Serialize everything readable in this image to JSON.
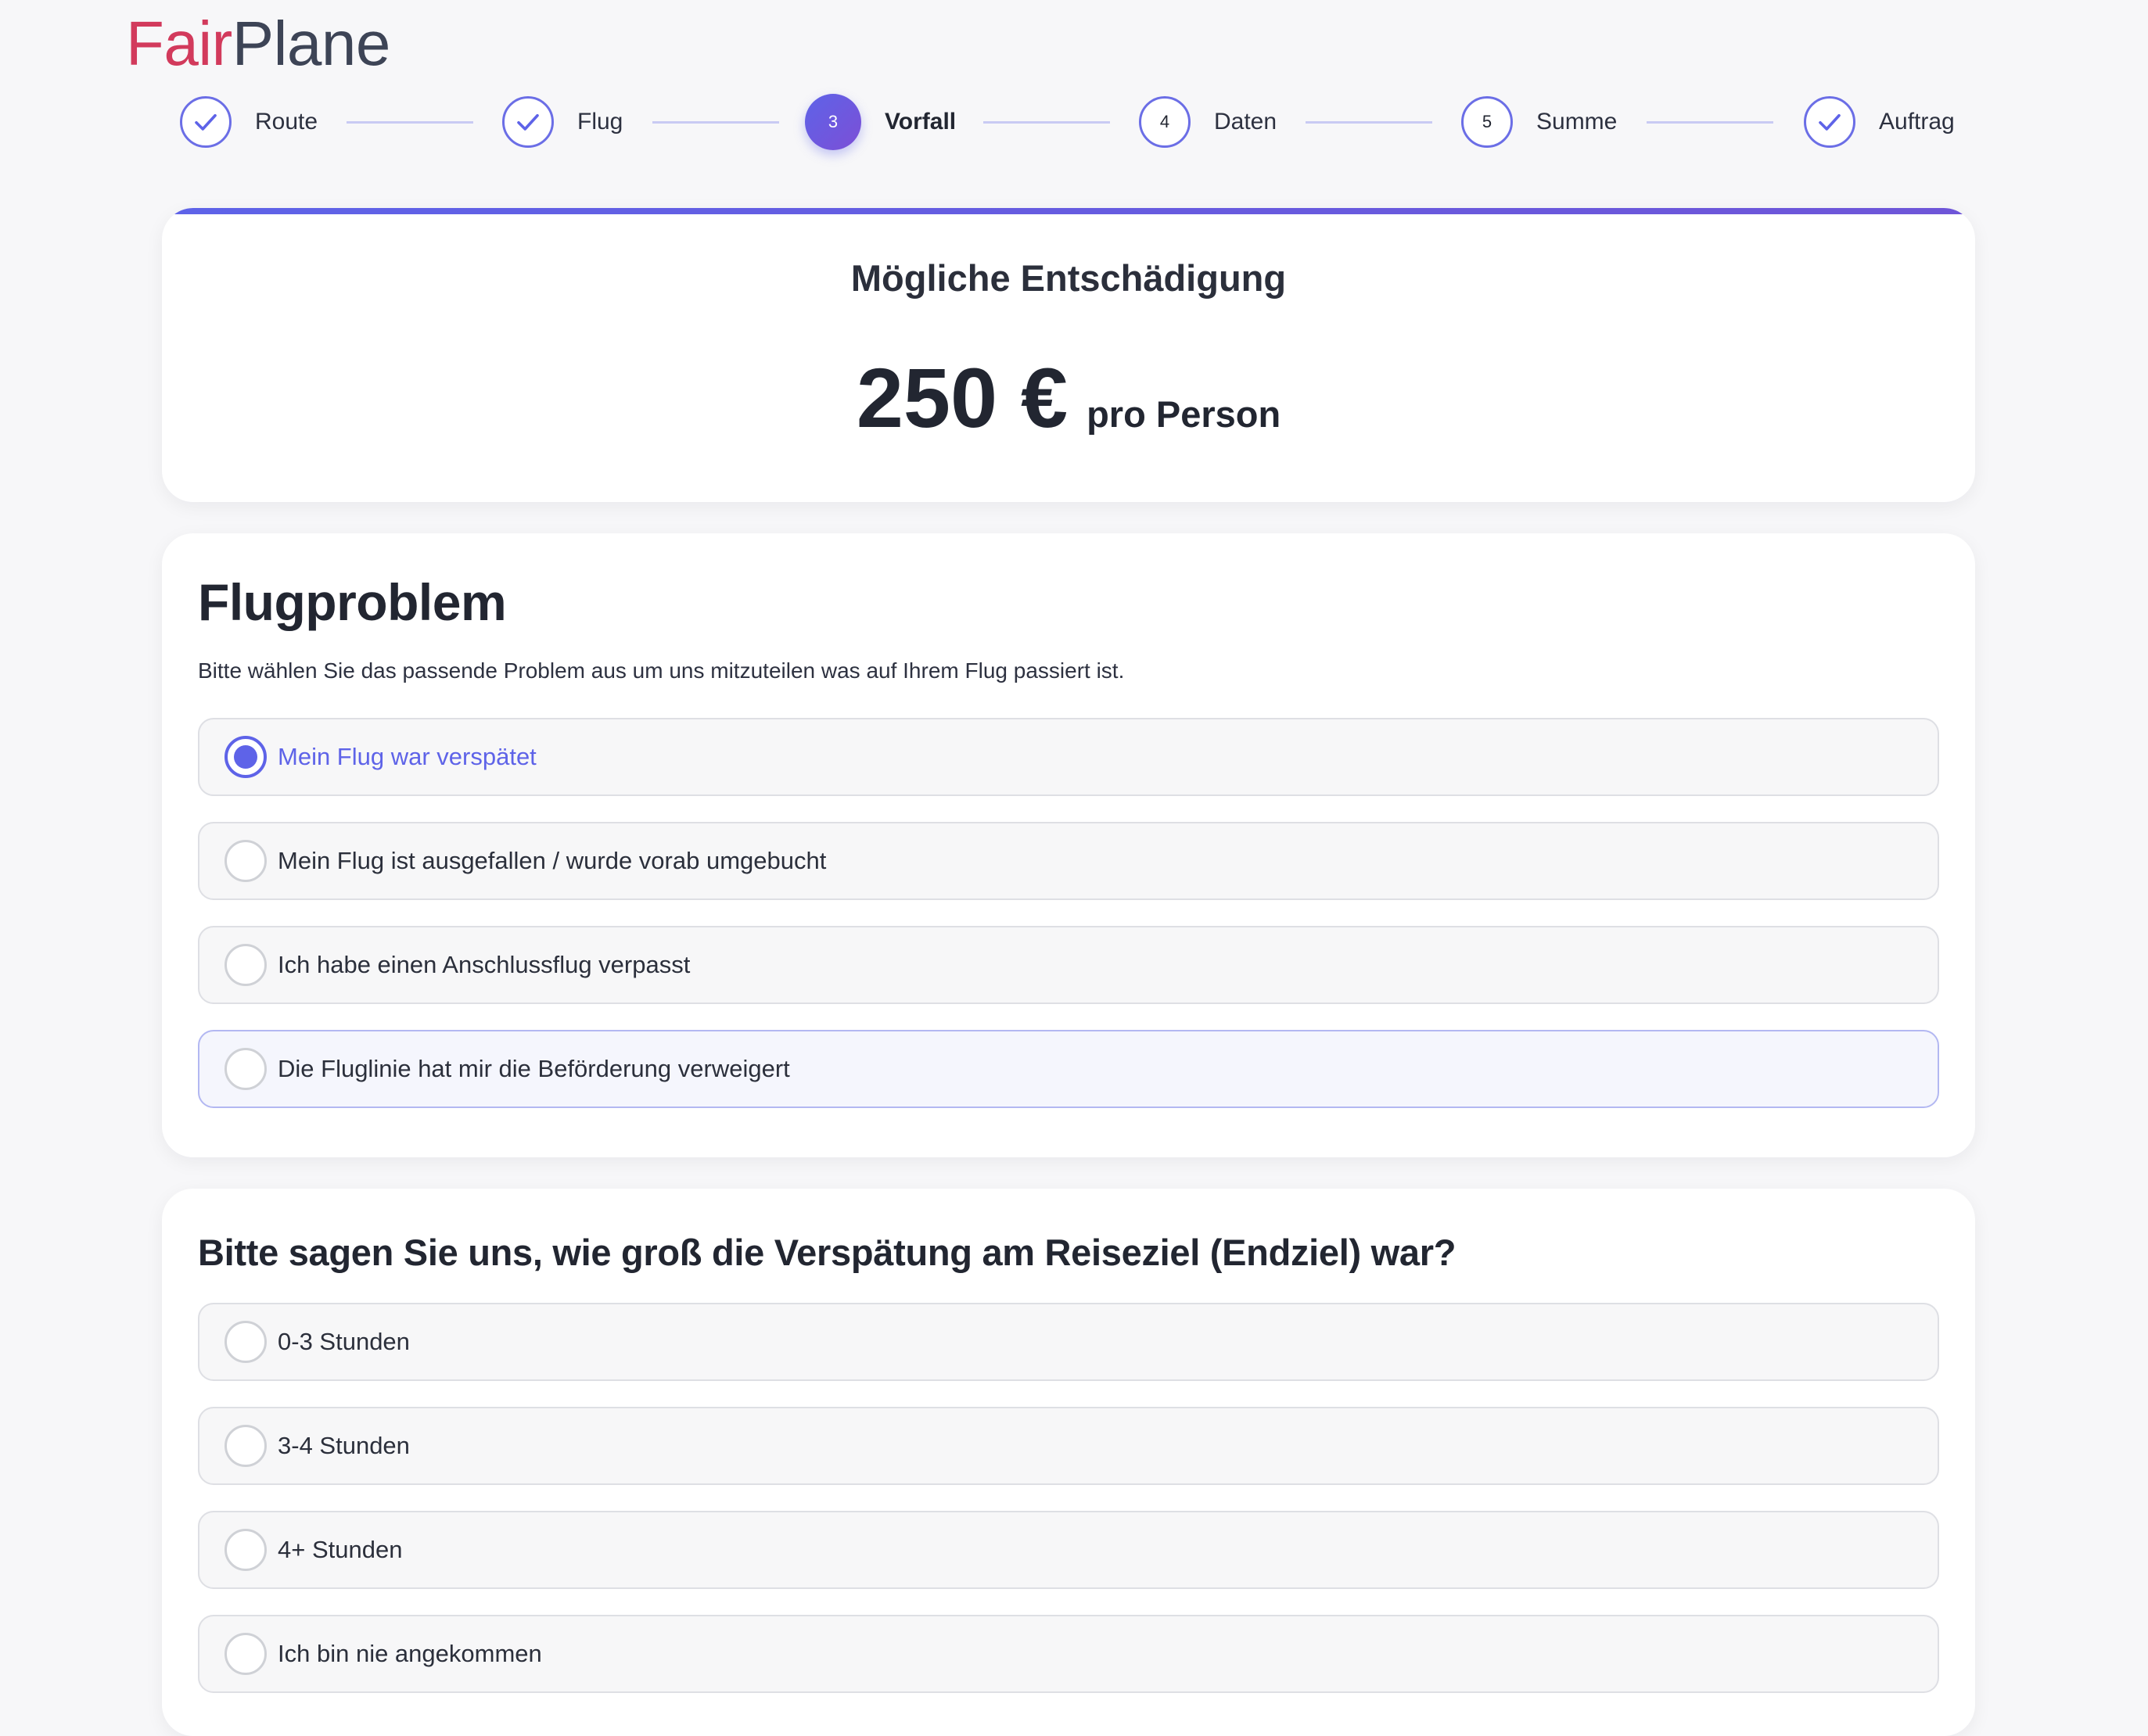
{
  "brand": {
    "part1": "Fair",
    "part2": "Plane"
  },
  "stepper": {
    "steps": [
      {
        "label": "Route",
        "state": "done"
      },
      {
        "label": "Flug",
        "state": "done"
      },
      {
        "label": "Vorfall",
        "number": "3",
        "state": "active"
      },
      {
        "label": "Daten",
        "number": "4",
        "state": "pending"
      },
      {
        "label": "Summe",
        "number": "5",
        "state": "pending"
      },
      {
        "label": "Auftrag",
        "state": "done"
      }
    ]
  },
  "compensation": {
    "title": "Mögliche Entschädigung",
    "amount": "250 €",
    "unit": "pro Person"
  },
  "problem": {
    "title": "Flugproblem",
    "subtitle": "Bitte wählen Sie das passende Problem aus um uns mitzuteilen was auf Ihrem Flug passiert ist.",
    "options": [
      {
        "label": "Mein Flug war verspätet",
        "selected": true
      },
      {
        "label": "Mein Flug ist ausgefallen / wurde vorab umgebucht",
        "selected": false
      },
      {
        "label": "Ich habe einen Anschlussflug verpasst",
        "selected": false
      },
      {
        "label": "Die Fluglinie hat mir die Beförderung verweigert",
        "selected": false
      }
    ]
  },
  "delay": {
    "title": "Bitte sagen Sie uns, wie groß die Verspätung am Reiseziel (Endziel) war?",
    "options": [
      {
        "label": "0-3 Stunden",
        "selected": false
      },
      {
        "label": "3-4 Stunden",
        "selected": false
      },
      {
        "label": "4+ Stunden",
        "selected": false
      },
      {
        "label": "Ich bin nie angekommen",
        "selected": false
      }
    ]
  },
  "colors": {
    "accent": "#5e63e8",
    "brand_red": "#d23a5c",
    "brand_dark": "#3d4456"
  }
}
